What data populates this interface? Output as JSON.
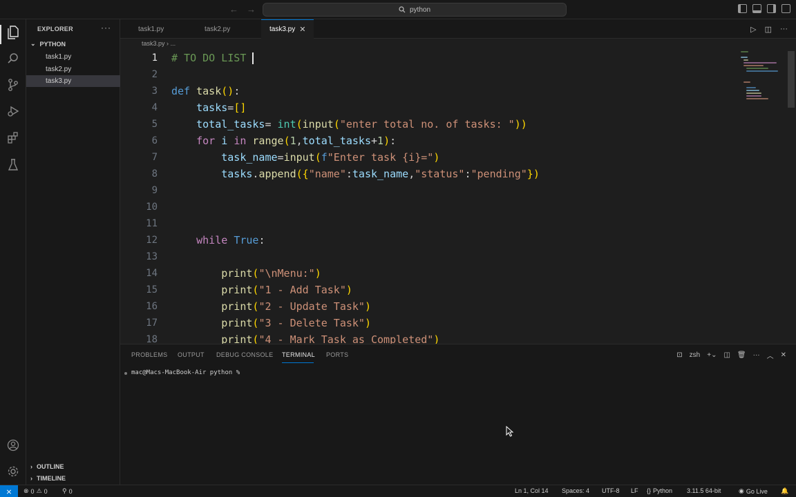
{
  "titlebar": {
    "search_label": "python"
  },
  "sidebar": {
    "header": "EXPLORER",
    "more": "···",
    "folder": "PYTHON",
    "files": [
      "task1.py",
      "task2.py",
      "task3.py"
    ],
    "selected_file": "task3.py",
    "outline": "OUTLINE",
    "timeline": "TIMELINE"
  },
  "tabs": [
    {
      "label": "task1.py",
      "active": false
    },
    {
      "label": "task2.py",
      "active": false
    },
    {
      "label": "task3.py",
      "active": true
    }
  ],
  "breadcrumb": {
    "file": "task3.py",
    "sep": "›",
    "rest": "..."
  },
  "editor": {
    "current_line": 1,
    "lines": [
      {
        "n": "1",
        "text": "# TO DO LIST "
      },
      {
        "n": "2",
        "text": ""
      },
      {
        "n": "3",
        "text": "def task():"
      },
      {
        "n": "4",
        "text": "    tasks=[]"
      },
      {
        "n": "5",
        "text": "    total_tasks= int(input(\"enter total no. of tasks: \"))"
      },
      {
        "n": "6",
        "text": "    for i in range(1,total_tasks+1):"
      },
      {
        "n": "7",
        "text": "        task_name=input(f\"Enter task {i}=\")"
      },
      {
        "n": "8",
        "text": "        tasks.append({\"name\":task_name,\"status\":\"pending\"})"
      },
      {
        "n": "9",
        "text": ""
      },
      {
        "n": "10",
        "text": ""
      },
      {
        "n": "11",
        "text": ""
      },
      {
        "n": "12",
        "text": "    while True:"
      },
      {
        "n": "13",
        "text": ""
      },
      {
        "n": "14",
        "text": "        print(\"\\nMenu:\")"
      },
      {
        "n": "15",
        "text": "        print(\"1 - Add Task\")"
      },
      {
        "n": "16",
        "text": "        print(\"2 - Update Task\")"
      },
      {
        "n": "17",
        "text": "        print(\"3 - Delete Task\")"
      },
      {
        "n": "18",
        "text": "        print(\"4 - Mark Task as Completed\")"
      }
    ]
  },
  "panel": {
    "tabs": [
      "PROBLEMS",
      "OUTPUT",
      "DEBUG CONSOLE",
      "TERMINAL",
      "PORTS"
    ],
    "active_tab": "TERMINAL",
    "shell": "zsh",
    "terminal_prompt": "mac@Macs-MacBook-Air python %"
  },
  "statusbar": {
    "errors": "0",
    "warnings": "0",
    "ports": "0",
    "position": "Ln 1, Col 14",
    "spaces": "Spaces: 4",
    "encoding": "UTF-8",
    "eol": "LF",
    "language": "Python",
    "interpreter": "3.11.5 64-bit",
    "go_live": "Go Live"
  },
  "colors": {
    "accent": "#0078d4",
    "keyword": "#569cd6",
    "control": "#c586c0",
    "function": "#dcdcaa",
    "string": "#ce9178",
    "variable": "#9cdcfe",
    "comment": "#6a9955"
  }
}
